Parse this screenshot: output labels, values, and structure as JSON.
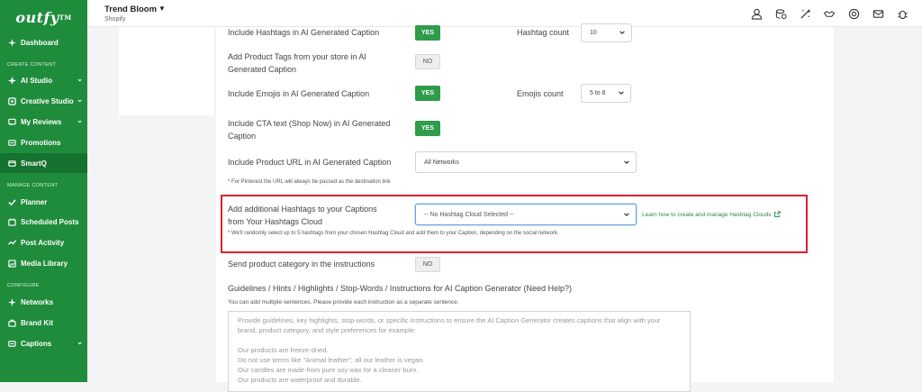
{
  "sidebar": {
    "logo": "outfy",
    "logo_tm": "TM",
    "items": [
      {
        "label": "Dashboard",
        "icon": "dashboard-icon",
        "chevron": false
      },
      {
        "label": "AI Studio",
        "icon": "ai-studio-icon",
        "chevron": true
      },
      {
        "label": "Creative Studio",
        "icon": "creative-studio-icon",
        "chevron": true
      },
      {
        "label": "My Reviews",
        "icon": "reviews-icon",
        "chevron": true
      },
      {
        "label": "Promotions",
        "icon": "promotions-icon",
        "chevron": false
      },
      {
        "label": "SmartQ",
        "icon": "smartq-icon",
        "chevron": false,
        "active": true
      },
      {
        "label": "Planner",
        "icon": "planner-icon",
        "chevron": false
      },
      {
        "label": "Scheduled Posts",
        "icon": "scheduled-posts-icon",
        "chevron": false
      },
      {
        "label": "Post Activity",
        "icon": "post-activity-icon",
        "chevron": false
      },
      {
        "label": "Media Library",
        "icon": "media-library-icon",
        "chevron": false
      },
      {
        "label": "Networks",
        "icon": "networks-icon",
        "chevron": false
      },
      {
        "label": "Brand Kit",
        "icon": "brand-kit-icon",
        "chevron": false
      },
      {
        "label": "Captions",
        "icon": "captions-icon",
        "chevron": true
      }
    ],
    "sections": [
      "CREATE CONTENT",
      "MANAGE CONTENT",
      "CONFIGURE"
    ]
  },
  "topbar": {
    "store_name": "Trend Bloom",
    "store_platform": "Shopify",
    "icons": [
      "user-icon",
      "billing-icon",
      "magic-tools-icon",
      "handshake-icon",
      "support-icon",
      "mail-icon",
      "bug-icon"
    ]
  },
  "settings": {
    "hashtags_label": "Include Hashtags in AI Generated Caption",
    "hashtags_value": "YES",
    "hashtag_count_label": "Hashtag count",
    "hashtag_count_value": "10",
    "product_tags_label_1": "Add Product Tags from your store in AI",
    "product_tags_label_2": "Generated Caption",
    "product_tags_value": "NO",
    "emojis_label": "Include Emojis in AI Generated Caption",
    "emojis_value": "YES",
    "emojis_count_label": "Emojis count",
    "emojis_count_value": "5 to 8",
    "cta_label_1": "Include CTA text (Shop Now) in AI Generated",
    "cta_label_2": "Caption",
    "cta_value": "YES",
    "product_url_label": "Include Product URL in AI Generated Caption",
    "product_url_value": "All Networks",
    "pinterest_note": "* For Pinterest the URL will always be passed as the destination link",
    "hashtag_cloud_label_1": "Add additional Hashtags to your Captions",
    "hashtag_cloud_label_2": "from Your Hashtags Cloud",
    "hashtag_cloud_value": "-- No Hashtag Cloud Selected --",
    "hashtag_cloud_link": "Learn how to create and manage Hashtag Clouds",
    "hashtag_cloud_note": "* We'll randomly select up to 5 hashtags from your chosen Hashtag Cloud and add them to your Caption, depending on the social network.",
    "product_category_label": "Send product category in the instructions",
    "product_category_value": "NO",
    "guidelines_title": "Guidelines / Hints / Highlights / Stop-Words / Instructions for AI Caption Generator (Need Help?)",
    "guidelines_sub": "You can add multiple sentences. Please provide each instruction as a separate sentence.",
    "guidelines_placeholder_lines": [
      "Provide guidelines, key highlights, stop-words, or specific instructions to ensure the AI Caption Generator creates captions that align with your",
      "brand, product category, and style preferences for example:",
      "",
      "Our products are freeze-dried.",
      "Do not use terms like \"Animal leather\"; all our leather is vegan.",
      "Our candles are made from pure soy wax for a cleaner burn.",
      "Our products are waterproof and durable."
    ]
  }
}
